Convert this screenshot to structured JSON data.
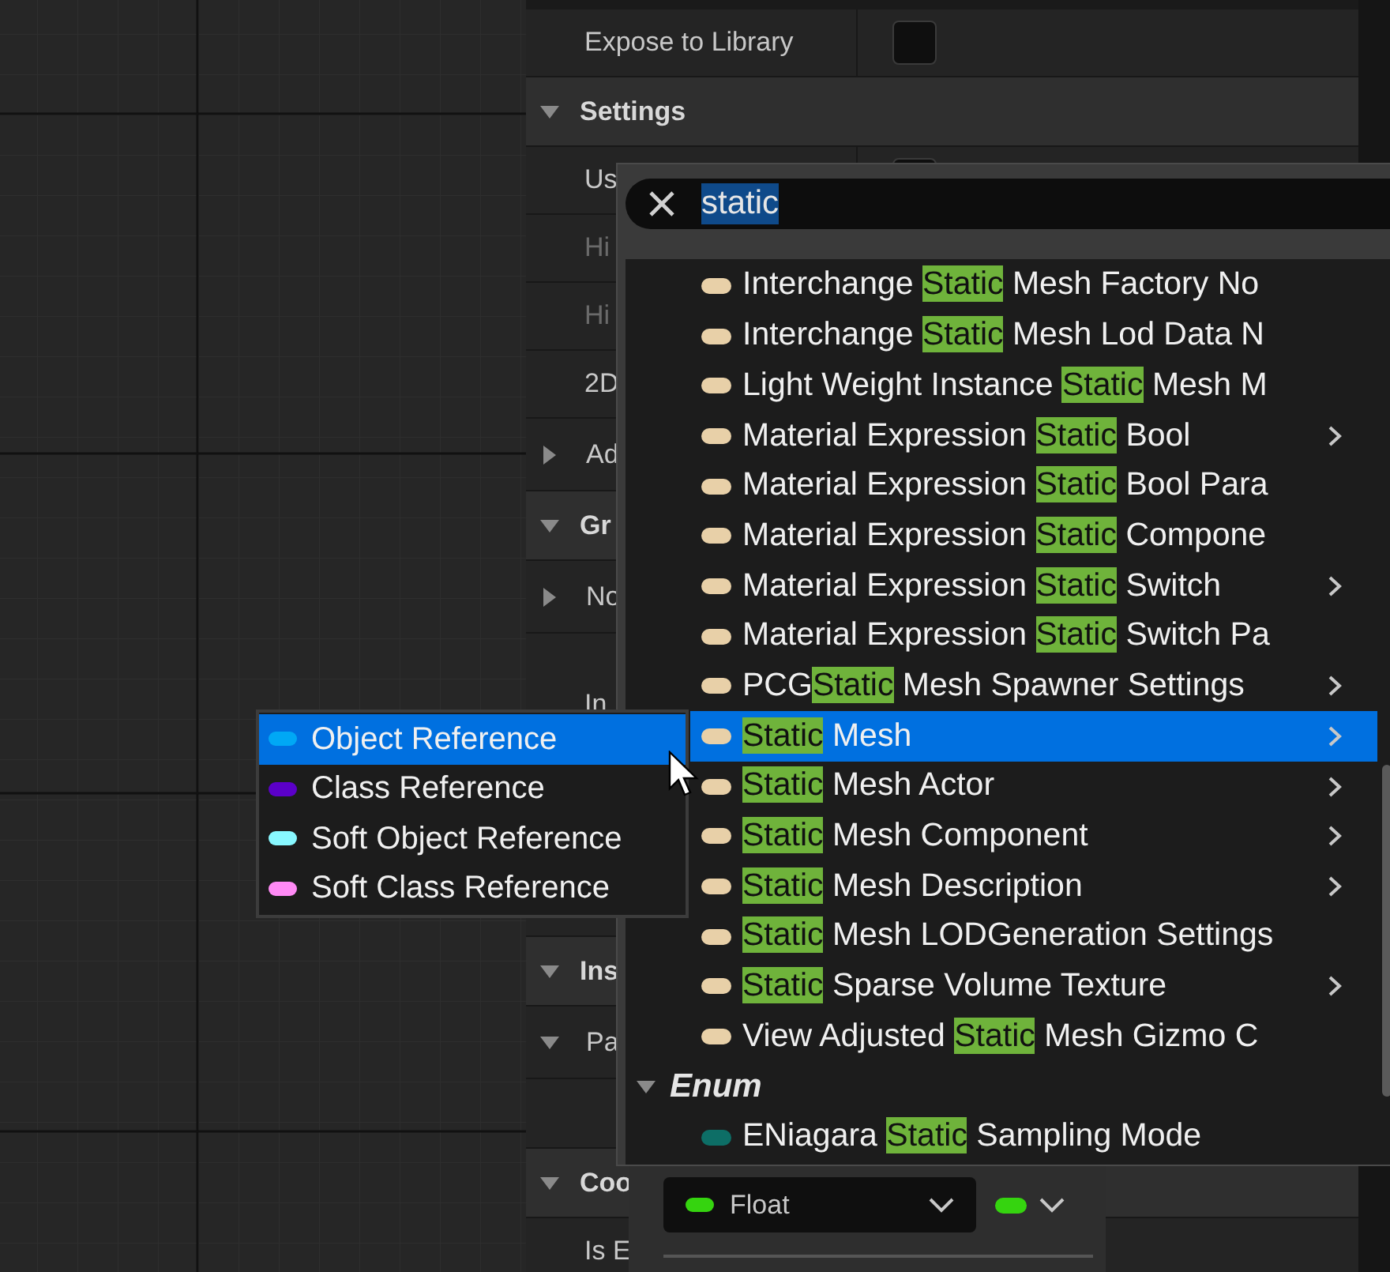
{
  "details": [
    {
      "kind": "row",
      "label": "Expose to Library",
      "checkbox": false
    },
    {
      "kind": "section",
      "label": "Settings",
      "expanded": true
    },
    {
      "kind": "row",
      "label": "Us",
      "checkbox": false
    },
    {
      "kind": "row",
      "label": "Hi",
      "disabled": true
    },
    {
      "kind": "row",
      "label": "Hi",
      "disabled": true
    },
    {
      "kind": "row",
      "label": "2D"
    },
    {
      "kind": "subsection",
      "label": "Ad",
      "expanded": false
    },
    {
      "kind": "section",
      "label": "Gr",
      "expanded": true
    },
    {
      "kind": "subsection",
      "label": "No",
      "expanded": false
    },
    {
      "kind": "tall",
      "label": "In"
    },
    {
      "kind": "gap"
    },
    {
      "kind": "section",
      "label": "Ins",
      "expanded": true
    },
    {
      "kind": "subsection",
      "label": "Pa",
      "expanded": true
    },
    {
      "kind": "blank"
    },
    {
      "kind": "section",
      "label": "Coo",
      "expanded": true
    },
    {
      "kind": "row",
      "label": "Is E"
    }
  ],
  "pin_type": {
    "value": "Float",
    "color": "#35d40f"
  },
  "popup": {
    "search": {
      "value": "static"
    },
    "groups": [
      {
        "items": [
          {
            "before": "Interchange ",
            "match": "Static",
            "after": " Mesh Factory No",
            "color": "#e8d0a8",
            "submenu": false,
            "selected": false
          },
          {
            "before": "Interchange ",
            "match": "Static",
            "after": " Mesh Lod Data N",
            "color": "#e8d0a8",
            "submenu": false,
            "selected": false
          },
          {
            "before": "Light Weight Instance ",
            "match": "Static",
            "after": " Mesh M",
            "color": "#e8d0a8",
            "submenu": false,
            "selected": false
          },
          {
            "before": "Material Expression ",
            "match": "Static",
            "after": " Bool",
            "color": "#e8d0a8",
            "submenu": true,
            "selected": false
          },
          {
            "before": "Material Expression ",
            "match": "Static",
            "after": " Bool Para",
            "color": "#e8d0a8",
            "submenu": false,
            "selected": false
          },
          {
            "before": "Material Expression ",
            "match": "Static",
            "after": " Compone",
            "color": "#e8d0a8",
            "submenu": false,
            "selected": false
          },
          {
            "before": "Material Expression ",
            "match": "Static",
            "after": " Switch",
            "color": "#e8d0a8",
            "submenu": true,
            "selected": false
          },
          {
            "before": "Material Expression ",
            "match": "Static",
            "after": " Switch Pa",
            "color": "#e8d0a8",
            "submenu": false,
            "selected": false
          },
          {
            "before": "PCG",
            "match": "Static",
            "after": " Mesh Spawner Settings",
            "color": "#e8d0a8",
            "submenu": true,
            "selected": false
          },
          {
            "match": "Static",
            "after": " Mesh",
            "color": "#e8d0a8",
            "submenu": true,
            "selected": true
          },
          {
            "match": "Static",
            "after": " Mesh Actor",
            "color": "#e8d0a8",
            "submenu": true,
            "selected": false
          },
          {
            "match": "Static",
            "after": " Mesh Component",
            "color": "#e8d0a8",
            "submenu": true,
            "selected": false
          },
          {
            "match": "Static",
            "after": " Mesh Description",
            "color": "#e8d0a8",
            "submenu": true,
            "selected": false
          },
          {
            "match": "Static",
            "after": " Mesh LODGeneration Settings",
            "color": "#e8d0a8",
            "submenu": false,
            "selected": false
          },
          {
            "match": "Static",
            "after": " Sparse Volume Texture",
            "color": "#e8d0a8",
            "submenu": true,
            "selected": false
          },
          {
            "before": "View Adjusted ",
            "match": "Static",
            "after": " Mesh Gizmo C",
            "color": "#e8d0a8",
            "submenu": false,
            "selected": false
          }
        ]
      },
      {
        "label": "Enum",
        "expanded": true,
        "items": [
          {
            "before": "ENiagara ",
            "match": "Static",
            "after": " Sampling Mode",
            "color": "#0d6e66",
            "submenu": false,
            "selected": false
          }
        ]
      }
    ]
  },
  "submenu": [
    {
      "label": "Object Reference",
      "color": "#00a8f5",
      "selected": true
    },
    {
      "label": "Class Reference",
      "color": "#5b00c8",
      "selected": false
    },
    {
      "label": "Soft Object Reference",
      "color": "#88f8ff",
      "selected": false
    },
    {
      "label": "Soft Class Reference",
      "color": "#ff8af5",
      "selected": false
    }
  ]
}
